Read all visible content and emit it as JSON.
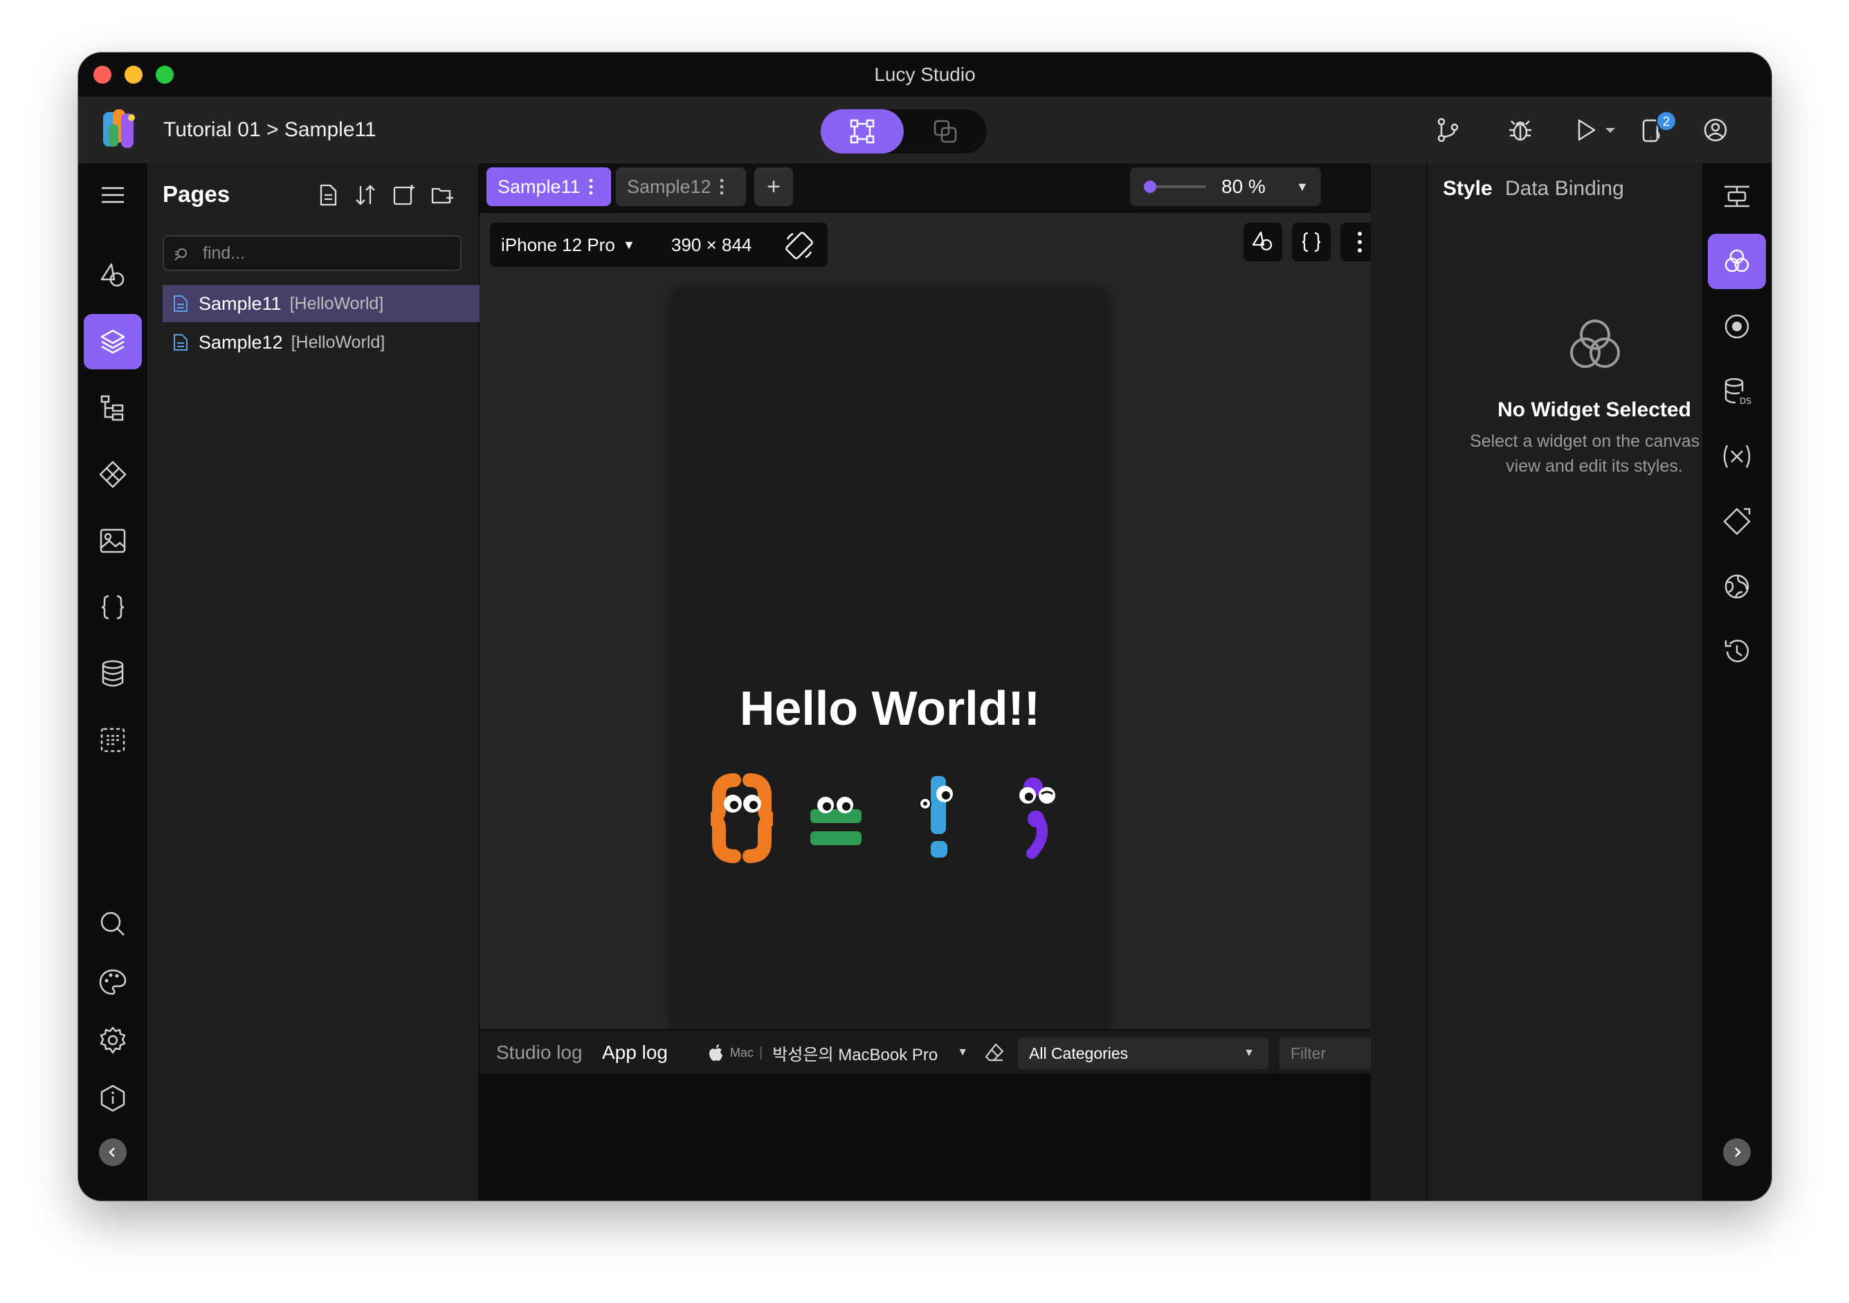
{
  "window": {
    "title": "Lucy Studio"
  },
  "header": {
    "breadcrumb": "Tutorial 01 > Sample11",
    "notification_count": "2"
  },
  "pages_panel": {
    "title": "Pages",
    "search_placeholder": "find...",
    "items": [
      {
        "name": "Sample11",
        "tag": "[HelloWorld]",
        "selected": true
      },
      {
        "name": "Sample12",
        "tag": "[HelloWorld]",
        "selected": false
      }
    ]
  },
  "editor": {
    "tabs": [
      {
        "label": "Sample11",
        "active": true
      },
      {
        "label": "Sample12",
        "active": false
      }
    ],
    "add_tab_label": "+",
    "zoom": {
      "label": "80 %",
      "value": 0.8
    },
    "device": {
      "name": "iPhone 12 Pro",
      "size": "390 × 844"
    },
    "canvas_text": "Hello World!!"
  },
  "log_panel": {
    "tabs": [
      "Studio log",
      "App log"
    ],
    "active_tab": "App log",
    "platform": "Mac",
    "device": "박성은의 MacBook Pro",
    "category": "All Categories",
    "filter_placeholder": "Filter"
  },
  "style_panel": {
    "tabs": [
      "Style",
      "Data Binding"
    ],
    "active_tab": "Style",
    "empty_title": "No Widget Selected",
    "empty_description": "Select a widget on the canvas to view and edit its styles."
  },
  "icons": {
    "left_sidebar": [
      "menu-icon",
      "widgets-icon",
      "layers-icon",
      "tree-icon",
      "components-icon",
      "image-icon",
      "code-icon",
      "database-icon",
      "dashed-list-icon",
      "search-icon",
      "palette-icon",
      "gear-icon",
      "info-icon",
      "collapse-left-icon"
    ],
    "right_sidebar": [
      "align-icon",
      "style-icon",
      "record-icon",
      "datasource-icon",
      "variable-icon",
      "diamond-icon",
      "globe-icon",
      "history-icon",
      "collapse-right-icon"
    ]
  },
  "colors": {
    "accent": "#8a63f2",
    "selected_row": "#464069",
    "traffic_red": "#fe5f57",
    "traffic_yellow": "#febc2e",
    "traffic_green": "#28c840"
  }
}
